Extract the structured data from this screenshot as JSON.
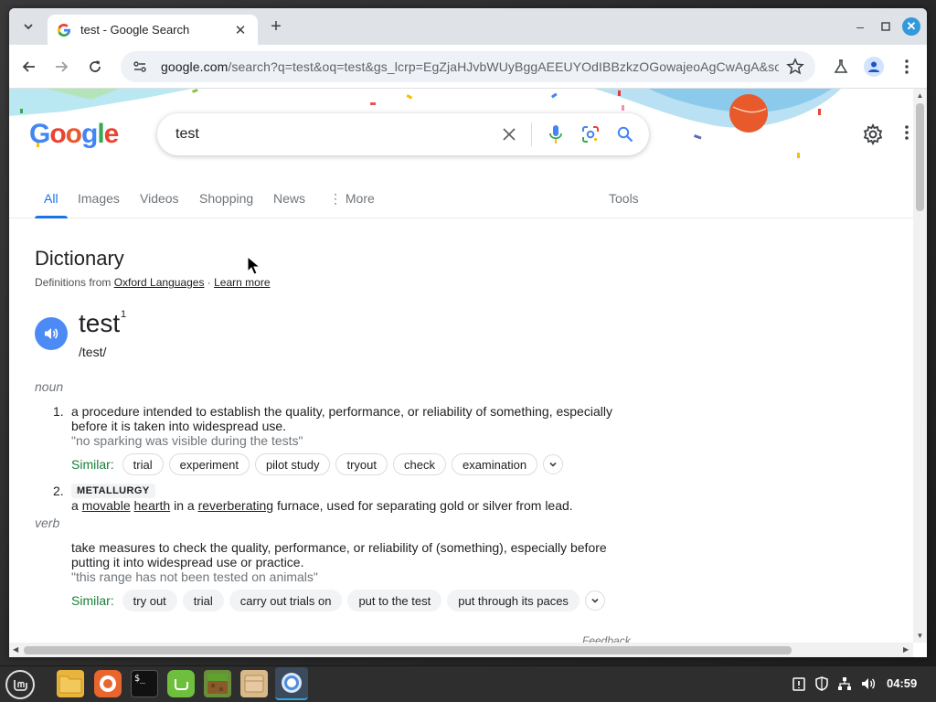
{
  "browser": {
    "tab_title": "test - Google Search",
    "new_tab_symbol": "+",
    "url_host": "google.com",
    "url_rest": "/search?q=test&oq=test&gs_lcrp=EgZjaHJvbWUyBggAEEUYOdIBBzkzOGowajeoAgCwAgA&sou...",
    "controls": {
      "minimize": "–",
      "maximize": "□",
      "close": "✕"
    }
  },
  "search": {
    "logo_text": "Google",
    "query": "test",
    "tabs": [
      "All",
      "Images",
      "Videos",
      "Shopping",
      "News",
      "More",
      "Tools"
    ],
    "active_tab": "All"
  },
  "dictionary": {
    "title": "Dictionary",
    "source_prefix": "Definitions from ",
    "source_link": "Oxford Languages",
    "source_sep": " · ",
    "learn_more": "Learn more",
    "word": "test",
    "superscript": "1",
    "phonetic": "/test/",
    "noun_label": "noun",
    "verb_label": "verb",
    "similar_label": "Similar:",
    "defs": {
      "n1_num": "1.",
      "n1_text": "a procedure intended to establish the quality, performance, or reliability of something, especially before it is taken into widespread use.",
      "n1_example": "\"no sparking was visible during the tests\"",
      "n1_similar": [
        "trial",
        "experiment",
        "pilot study",
        "tryout",
        "check",
        "examination"
      ],
      "n2_num": "2.",
      "n2_badge": "METALLURGY",
      "n2_parts": [
        "a ",
        "movable",
        " ",
        "hearth",
        " in a ",
        "reverberating",
        " furnace, used for separating gold or silver from lead."
      ],
      "v1_text": "take measures to check the quality, performance, or reliability of (something), especially before putting it into widespread use or practice.",
      "v1_example": "\"this range has not been tested on animals\"",
      "v1_similar": [
        "try out",
        "trial",
        "carry out trials on",
        "put to the test",
        "put through its paces"
      ]
    },
    "feedback": "Feedback"
  },
  "taskbar": {
    "clock": "04:59"
  },
  "colors": {
    "google_blue": "#4285f4",
    "google_red": "#ea4335",
    "google_yellow": "#fbbc05",
    "google_green": "#34a853",
    "link_blue": "#1a73e8",
    "similar_green": "#188038"
  }
}
